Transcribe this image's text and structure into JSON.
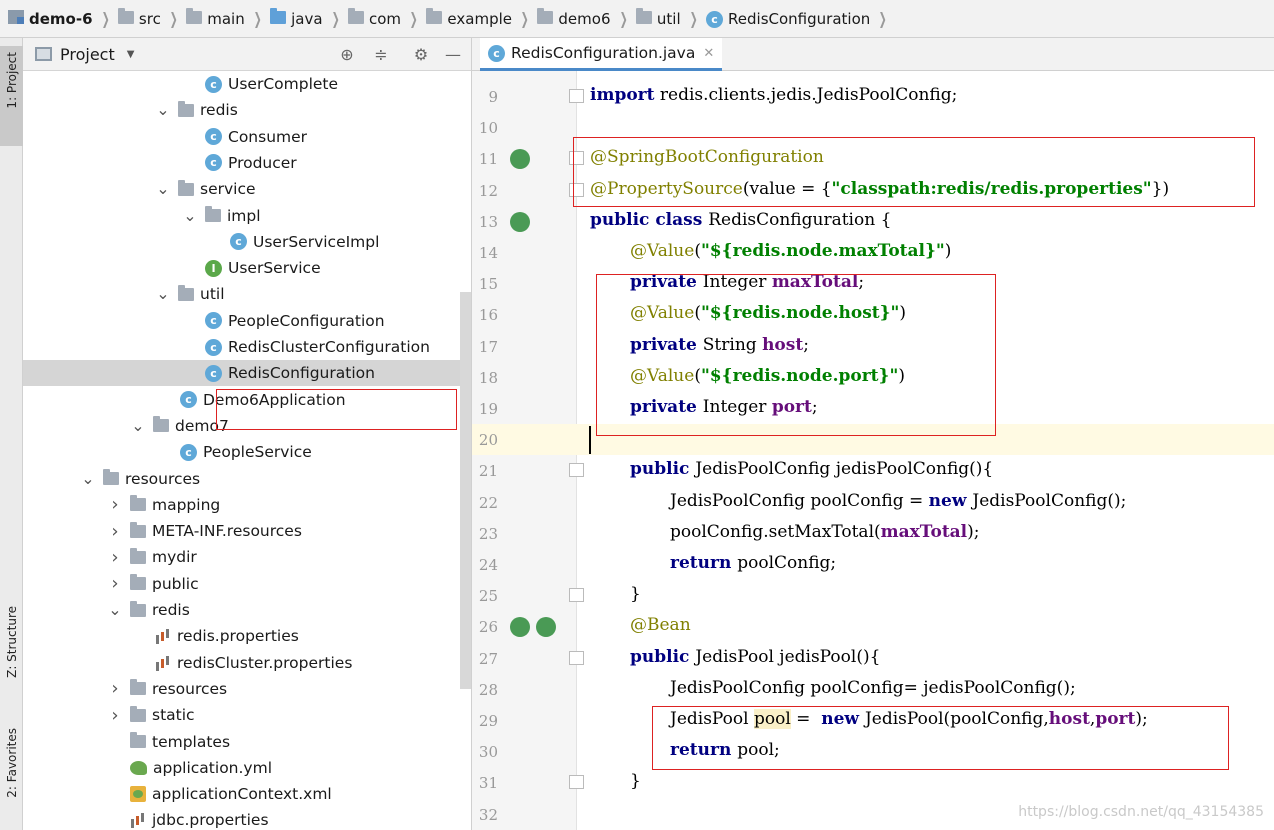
{
  "breadcrumb": [
    "demo-6",
    "src",
    "main",
    "java",
    "com",
    "example",
    "demo6",
    "util",
    "RedisConfiguration"
  ],
  "left_strip": {
    "project": "1: Project",
    "structure": "Z: Structure",
    "favorites": "2: Favorites"
  },
  "project_panel": {
    "title": "Project"
  },
  "tree": [
    {
      "label": "UserComplete",
      "icon": "class"
    },
    {
      "label": "redis",
      "icon": "package",
      "expanded": true
    },
    {
      "label": "Consumer",
      "icon": "class"
    },
    {
      "label": "Producer",
      "icon": "class"
    },
    {
      "label": "service",
      "icon": "package",
      "expanded": true
    },
    {
      "label": "impl",
      "icon": "package",
      "expanded": true
    },
    {
      "label": "UserServiceImpl",
      "icon": "class"
    },
    {
      "label": "UserService",
      "icon": "interface"
    },
    {
      "label": "util",
      "icon": "package",
      "expanded": true
    },
    {
      "label": "PeopleConfiguration",
      "icon": "class"
    },
    {
      "label": "RedisClusterConfiguration",
      "icon": "class"
    },
    {
      "label": "RedisConfiguration",
      "icon": "class",
      "selected": true
    },
    {
      "label": "Demo6Application",
      "icon": "spring-class"
    },
    {
      "label": "demo7",
      "icon": "package",
      "expanded": true
    },
    {
      "label": "PeopleService",
      "icon": "class"
    },
    {
      "label": "resources",
      "icon": "resources-folder",
      "expanded": true
    },
    {
      "label": "mapping",
      "icon": "folder",
      "expanded": false
    },
    {
      "label": "META-INF.resources",
      "icon": "folder",
      "expanded": false
    },
    {
      "label": "mydir",
      "icon": "folder",
      "expanded": false
    },
    {
      "label": "public",
      "icon": "folder",
      "expanded": false
    },
    {
      "label": "redis",
      "icon": "folder",
      "expanded": true
    },
    {
      "label": "redis.properties",
      "icon": "properties"
    },
    {
      "label": "redisCluster.properties",
      "icon": "properties"
    },
    {
      "label": "resources",
      "icon": "folder",
      "expanded": false
    },
    {
      "label": "static",
      "icon": "folder",
      "expanded": false
    },
    {
      "label": "templates",
      "icon": "folder"
    },
    {
      "label": "application.yml",
      "icon": "yml"
    },
    {
      "label": "applicationContext.xml",
      "icon": "xml"
    },
    {
      "label": "jdbc.properties",
      "icon": "properties"
    }
  ],
  "editor": {
    "tab_label": "RedisConfiguration.java",
    "lines": [
      {
        "num": "9",
        "parts": [
          [
            "kw",
            "import"
          ],
          [
            "",
            "redis.clients.jedis.JedisPoolConfig;"
          ]
        ]
      },
      {
        "num": "10",
        "parts": []
      },
      {
        "num": "11",
        "parts": [
          [
            "ann",
            "@SpringBootConfiguration"
          ]
        ]
      },
      {
        "num": "12",
        "parts": [
          [
            "ann",
            "@PropertySource"
          ],
          [
            "",
            "(value = {"
          ],
          [
            "str",
            "\"classpath:redis/redis.properties\""
          ],
          [
            "",
            "})"
          ]
        ]
      },
      {
        "num": "13",
        "parts": [
          [
            "kw",
            "public class "
          ],
          [
            "",
            "RedisConfiguration {"
          ]
        ]
      },
      {
        "num": "14",
        "parts": [
          [
            "ann",
            "@Value"
          ],
          [
            "",
            "("
          ],
          [
            "str",
            "\"${redis.node.maxTotal}\""
          ],
          [
            "",
            ")"
          ]
        ]
      },
      {
        "num": "15",
        "parts": [
          [
            "kw",
            "private "
          ],
          [
            "",
            "Integer "
          ],
          [
            "fld",
            "maxTotal"
          ],
          [
            "",
            ";"
          ]
        ]
      },
      {
        "num": "16",
        "parts": [
          [
            "ann",
            "@Value"
          ],
          [
            "",
            "("
          ],
          [
            "str",
            "\"${redis.node.host}\""
          ],
          [
            "",
            ")"
          ]
        ]
      },
      {
        "num": "17",
        "parts": [
          [
            "kw",
            "private "
          ],
          [
            "",
            "String "
          ],
          [
            "fld",
            "host"
          ],
          [
            "",
            ";"
          ]
        ]
      },
      {
        "num": "18",
        "parts": [
          [
            "ann",
            "@Value"
          ],
          [
            "",
            "("
          ],
          [
            "str",
            "\"${redis.node.port}\""
          ],
          [
            "",
            ")"
          ]
        ]
      },
      {
        "num": "19",
        "parts": [
          [
            "kw",
            "private "
          ],
          [
            "",
            "Integer "
          ],
          [
            "fld",
            "port"
          ],
          [
            "",
            ";"
          ]
        ]
      },
      {
        "num": "20",
        "parts": []
      },
      {
        "num": "21",
        "parts": [
          [
            "kw",
            "public "
          ],
          [
            "",
            "JedisPoolConfig jedisPoolConfig(){"
          ]
        ]
      },
      {
        "num": "22",
        "parts": [
          [
            "",
            "JedisPoolConfig poolConfig = "
          ],
          [
            "kw",
            "new "
          ],
          [
            "",
            "JedisPoolConfig();"
          ]
        ]
      },
      {
        "num": "23",
        "parts": [
          [
            "",
            "poolConfig.setMaxTotal("
          ],
          [
            "fld",
            "maxTotal"
          ],
          [
            "",
            ");"
          ]
        ]
      },
      {
        "num": "24",
        "parts": [
          [
            "kw",
            "return "
          ],
          [
            "",
            "poolConfig;"
          ]
        ]
      },
      {
        "num": "25",
        "parts": [
          [
            "",
            "}"
          ]
        ]
      },
      {
        "num": "26",
        "parts": [
          [
            "ann",
            "@Bean"
          ]
        ]
      },
      {
        "num": "27",
        "parts": [
          [
            "kw",
            "public "
          ],
          [
            "",
            "JedisPool jedisPool(){"
          ]
        ]
      },
      {
        "num": "28",
        "parts": [
          [
            "",
            "JedisPoolConfig poolConfig= jedisPoolConfig();"
          ]
        ]
      },
      {
        "num": "29",
        "parts": [
          [
            "",
            "JedisPool "
          ],
          [
            "hl",
            "pool"
          ],
          [
            "",
            " =  "
          ],
          [
            "kw",
            "new "
          ],
          [
            "",
            "JedisPool(poolConfig,"
          ],
          [
            "fld",
            "host"
          ],
          [
            "",
            ","
          ],
          [
            "fld",
            "port"
          ],
          [
            "",
            ");"
          ]
        ]
      },
      {
        "num": "30",
        "parts": [
          [
            "kw",
            "return "
          ],
          [
            "",
            "pool;"
          ]
        ]
      },
      {
        "num": "31",
        "parts": [
          [
            "",
            "}"
          ]
        ]
      },
      {
        "num": "32",
        "parts": []
      }
    ]
  },
  "watermark": "https://blog.csdn.net/qq_43154385"
}
